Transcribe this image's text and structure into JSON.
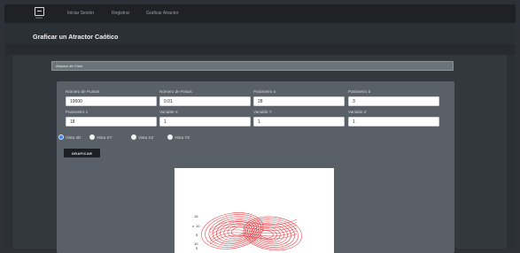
{
  "nav": {
    "logo_caption": "Inicio",
    "links": [
      "Iniciar Sesión",
      "Registrar",
      "Graficar Atractor"
    ]
  },
  "page": {
    "title": "Graficar un Atractor Caótico"
  },
  "section": {
    "title": "Atractor de Chen"
  },
  "form": {
    "fields": [
      {
        "label": "Número de Puntos",
        "value": "10000"
      },
      {
        "label": "Número de Pasos",
        "value": "0.01"
      },
      {
        "label": "Parámetro a",
        "value": "28"
      },
      {
        "label": "Parámetro b",
        "value": "3"
      },
      {
        "label": "Parámetro c",
        "value": "18"
      },
      {
        "label": "Variable X",
        "value": "1"
      },
      {
        "label": "Variable Y",
        "value": "1"
      },
      {
        "label": "Variable Z",
        "value": "1"
      }
    ],
    "views": [
      {
        "label": "Vista 3D",
        "selected": true
      },
      {
        "label": "Vista XY",
        "selected": false
      },
      {
        "label": "Vista XZ",
        "selected": false
      },
      {
        "label": "Vista YZ",
        "selected": false
      }
    ],
    "submit_label": "GRAFICAR"
  },
  "plot": {
    "ticks": [
      "15",
      "10",
      "5",
      "10",
      "5"
    ],
    "axis_letter": "z",
    "line_color": "#e4141b"
  },
  "colors": {
    "navbar": "#1f2125",
    "panel": "#596067",
    "accent": "#3b82f6"
  }
}
